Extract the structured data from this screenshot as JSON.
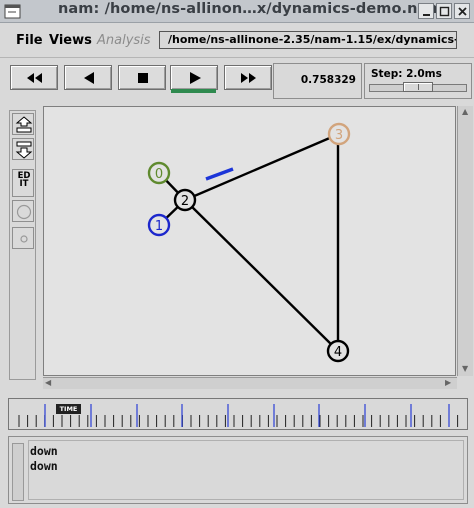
{
  "window": {
    "title": "nam: /home/ns-allinon…x/dynamics-demo.nam"
  },
  "menu": {
    "file": "File",
    "views": "Views",
    "analysis": "Analysis",
    "path": "/home/ns-allinone-2.35/nam-1.15/ex/dynamics-demo.nam"
  },
  "controls": {
    "time_value": "0.758329",
    "step_label": "Step: 2.0ms"
  },
  "toolbar": {
    "edit_label": "ED IT"
  },
  "network": {
    "nodes": [
      {
        "label": "0",
        "color": "#5f8a2e"
      },
      {
        "label": "1",
        "color": "#1c27cc"
      },
      {
        "label": "2",
        "color": "#000000"
      },
      {
        "label": "3",
        "color": "#d2a47c"
      },
      {
        "label": "4",
        "color": "#000000"
      }
    ],
    "packet_color": "#1c35d8",
    "link_color": "#000000"
  },
  "timeline": {
    "marker_label": "TIME"
  },
  "log": {
    "lines": [
      "down",
      "down"
    ]
  }
}
